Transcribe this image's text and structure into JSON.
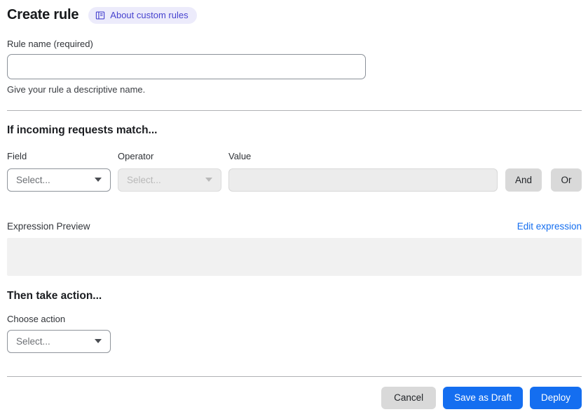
{
  "header": {
    "title": "Create rule",
    "about_link_label": "About custom rules"
  },
  "rule_name": {
    "label": "Rule name (required)",
    "value": "",
    "placeholder": "",
    "helper": "Give your rule a descriptive name."
  },
  "match_section": {
    "heading": "If incoming requests match...",
    "field": {
      "label": "Field",
      "selected": "Select..."
    },
    "operator": {
      "label": "Operator",
      "selected": "Select...",
      "disabled": true
    },
    "value": {
      "label": "Value",
      "value": "",
      "disabled": true
    },
    "and_label": "And",
    "or_label": "Or",
    "expression_preview_label": "Expression Preview",
    "edit_expression_label": "Edit expression",
    "expression_value": ""
  },
  "action_section": {
    "heading": "Then take action...",
    "choose_label": "Choose action",
    "selected": "Select..."
  },
  "footer": {
    "cancel_label": "Cancel",
    "save_draft_label": "Save as Draft",
    "deploy_label": "Deploy"
  },
  "colors": {
    "accent_blue": "#146ef0",
    "badge_bg": "#ecebfb",
    "badge_text": "#4743cf",
    "gray_button": "#d9d9d9",
    "disabled_bg": "#ececec",
    "preview_bg": "#f1f1f1"
  },
  "icons": {
    "about_icon": "book-icon",
    "select_caret": "chevron-down-icon"
  }
}
